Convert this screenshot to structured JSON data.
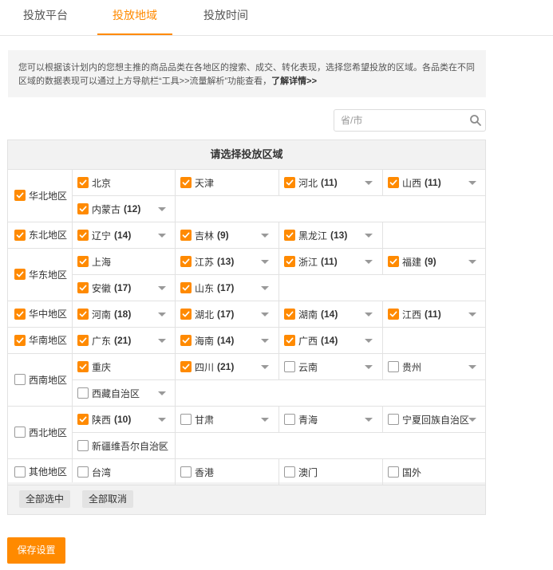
{
  "tabs": [
    {
      "label": "投放平台",
      "active": false
    },
    {
      "label": "投放地域",
      "active": true
    },
    {
      "label": "投放时间",
      "active": false
    }
  ],
  "notice": {
    "text": "您可以根据该计划内的您想主推的商品品类在各地区的搜索、成交、转化表现，选择您希望投放的区域。各品类在不同区域的数据表现可以通过上方导航栏“工具>>流量解析”功能查看，",
    "link": "了解详情>>"
  },
  "search": {
    "placeholder": "省/市",
    "value": "",
    "icon": "search-icon"
  },
  "panel": {
    "title": "请选择投放区域"
  },
  "regions": [
    {
      "name": "华北地区",
      "checked": true,
      "provinces": [
        {
          "name": "北京",
          "count": "",
          "checked": true,
          "dropdown": false
        },
        {
          "name": "天津",
          "count": "",
          "checked": true,
          "dropdown": false
        },
        {
          "name": "河北",
          "count": "(11)",
          "checked": true,
          "dropdown": true
        },
        {
          "name": "山西",
          "count": "(11)",
          "checked": true,
          "dropdown": true
        },
        {
          "name": "内蒙古",
          "count": "(12)",
          "checked": true,
          "dropdown": true
        }
      ]
    },
    {
      "name": "东北地区",
      "checked": true,
      "provinces": [
        {
          "name": "辽宁",
          "count": "(14)",
          "checked": true,
          "dropdown": true
        },
        {
          "name": "吉林",
          "count": "(9)",
          "checked": true,
          "dropdown": true
        },
        {
          "name": "黑龙江",
          "count": "(13)",
          "checked": true,
          "dropdown": true
        }
      ]
    },
    {
      "name": "华东地区",
      "checked": true,
      "provinces": [
        {
          "name": "上海",
          "count": "",
          "checked": true,
          "dropdown": false
        },
        {
          "name": "江苏",
          "count": "(13)",
          "checked": true,
          "dropdown": true
        },
        {
          "name": "浙江",
          "count": "(11)",
          "checked": true,
          "dropdown": true
        },
        {
          "name": "福建",
          "count": "(9)",
          "checked": true,
          "dropdown": true
        },
        {
          "name": "安徽",
          "count": "(17)",
          "checked": true,
          "dropdown": true
        },
        {
          "name": "山东",
          "count": "(17)",
          "checked": true,
          "dropdown": true
        }
      ]
    },
    {
      "name": "华中地区",
      "checked": true,
      "provinces": [
        {
          "name": "河南",
          "count": "(18)",
          "checked": true,
          "dropdown": true
        },
        {
          "name": "湖北",
          "count": "(17)",
          "checked": true,
          "dropdown": true
        },
        {
          "name": "湖南",
          "count": "(14)",
          "checked": true,
          "dropdown": true
        },
        {
          "name": "江西",
          "count": "(11)",
          "checked": true,
          "dropdown": true
        }
      ]
    },
    {
      "name": "华南地区",
      "checked": true,
      "provinces": [
        {
          "name": "广东",
          "count": "(21)",
          "checked": true,
          "dropdown": true
        },
        {
          "name": "海南",
          "count": "(14)",
          "checked": true,
          "dropdown": true
        },
        {
          "name": "广西",
          "count": "(14)",
          "checked": true,
          "dropdown": true
        }
      ]
    },
    {
      "name": "西南地区",
      "checked": false,
      "provinces": [
        {
          "name": "重庆",
          "count": "",
          "checked": true,
          "dropdown": false
        },
        {
          "name": "四川",
          "count": "(21)",
          "checked": true,
          "dropdown": true
        },
        {
          "name": "云南",
          "count": "",
          "checked": false,
          "dropdown": true
        },
        {
          "name": "贵州",
          "count": "",
          "checked": false,
          "dropdown": true
        },
        {
          "name": "西藏自治区",
          "count": "",
          "checked": false,
          "dropdown": true
        }
      ]
    },
    {
      "name": "西北地区",
      "checked": false,
      "provinces": [
        {
          "name": "陕西",
          "count": "(10)",
          "checked": true,
          "dropdown": true
        },
        {
          "name": "甘肃",
          "count": "",
          "checked": false,
          "dropdown": true
        },
        {
          "name": "青海",
          "count": "",
          "checked": false,
          "dropdown": true
        },
        {
          "name": "宁夏回族自治区",
          "count": "",
          "checked": false,
          "dropdown": true
        },
        {
          "name": "新疆维吾尔自治区",
          "count": "",
          "checked": false,
          "dropdown": true
        }
      ]
    },
    {
      "name": "其他地区",
      "checked": false,
      "provinces": [
        {
          "name": "台湾",
          "count": "",
          "checked": false,
          "dropdown": false
        },
        {
          "name": "香港",
          "count": "",
          "checked": false,
          "dropdown": false
        },
        {
          "name": "澳门",
          "count": "",
          "checked": false,
          "dropdown": false
        },
        {
          "name": "国外",
          "count": "",
          "checked": false,
          "dropdown": false
        }
      ]
    }
  ],
  "actions": {
    "select_all": "全部选中",
    "deselect_all": "全部取消"
  },
  "save_button": "保存设置",
  "colors": {
    "accent": "#ff8a00",
    "border": "#e2e2e2",
    "header_bg": "#f2f2f2",
    "notice_bg": "#f4f4f4"
  }
}
